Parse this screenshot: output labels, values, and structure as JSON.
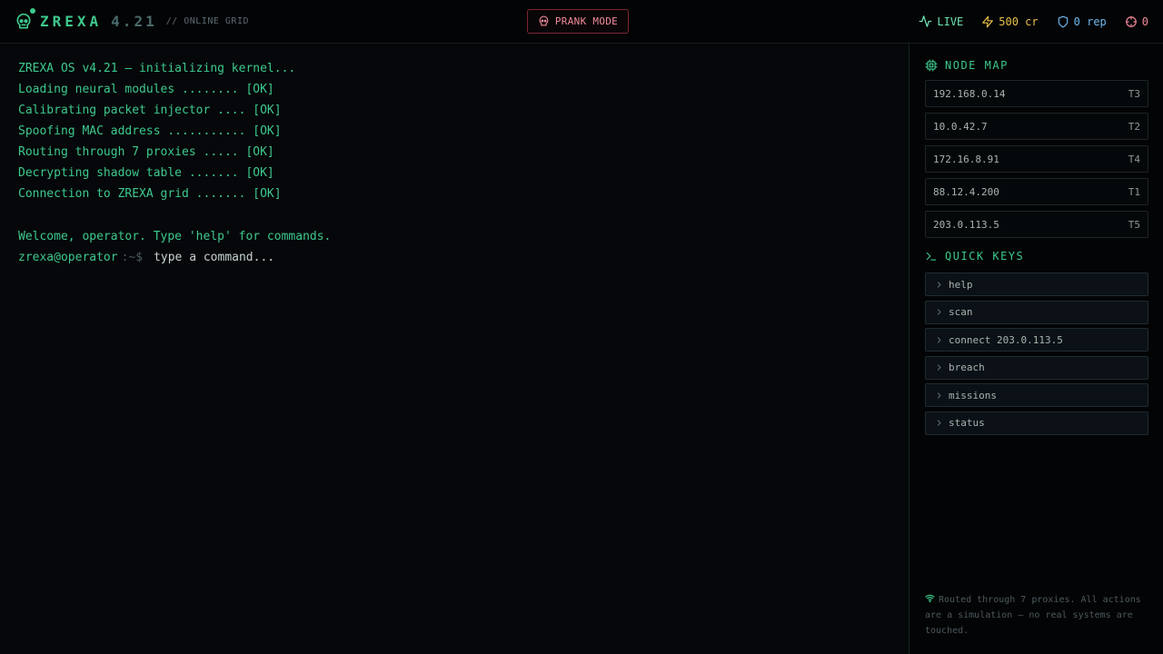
{
  "header": {
    "brand": "ZREXA",
    "version": "4.21",
    "tag": "// ONLINE GRID",
    "prank_label": "PRANK MODE",
    "stats": {
      "live": "LIVE",
      "credits": "500 cr",
      "rep": "0 rep",
      "targets": "0"
    }
  },
  "terminal": {
    "lines": [
      "ZREXA OS v4.21 — initializing kernel...",
      "Loading neural modules ........ [OK]",
      "Calibrating packet injector .... [OK]",
      "Spoofing MAC address ........... [OK]",
      "Routing through 7 proxies ..... [OK]",
      "Decrypting shadow table ....... [OK]",
      "Connection to ZREXA grid ....... [OK]",
      "",
      "Welcome, operator. Type 'help' for commands."
    ],
    "prompt_user": "zrexa@operator",
    "prompt_path": ":~$",
    "input_placeholder": "type a command..."
  },
  "sidebar": {
    "node_map_title": "NODE MAP",
    "nodes": [
      {
        "ip": "192.168.0.14",
        "tier": "T3"
      },
      {
        "ip": "10.0.42.7",
        "tier": "T2"
      },
      {
        "ip": "172.16.8.91",
        "tier": "T4"
      },
      {
        "ip": "88.12.4.200",
        "tier": "T1"
      },
      {
        "ip": "203.0.113.5",
        "tier": "T5"
      }
    ],
    "quick_keys_title": "QUICK KEYS",
    "quick_keys": [
      "help",
      "scan",
      "connect 203.0.113.5",
      "breach",
      "missions",
      "status"
    ],
    "footer_note": "Routed through 7 proxies. All actions are a simulation — no real systems are touched."
  },
  "icons": {
    "logo": "skull-icon",
    "prank": "skull-icon",
    "live": "activity-icon",
    "credits": "lightning-icon",
    "rep": "shield-icon",
    "targets": "crosshair-icon",
    "node_map": "cpu-chip-icon",
    "quick_keys": "terminal-prompt-icon",
    "key": "chevron-right-icon",
    "footer": "wifi-icon"
  },
  "colors": {
    "accent": "#3ec98d",
    "prank": "#f08a9a",
    "credits": "#e8c04a",
    "rep": "#6fb8f0"
  }
}
